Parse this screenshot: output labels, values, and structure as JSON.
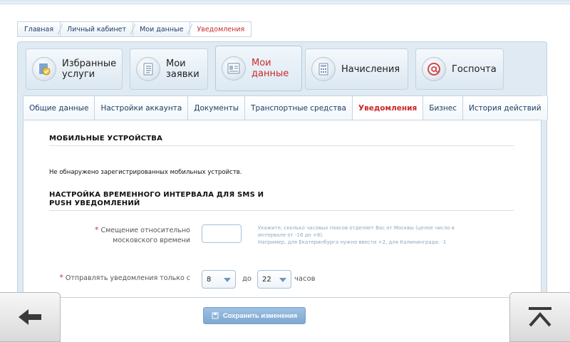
{
  "breadcrumb": [
    "Главная",
    "Личный кабинет",
    "Мои данные",
    "Уведомления"
  ],
  "big_tabs": [
    {
      "label": "Избранные\nуслуги",
      "icon": "favorite-services-icon",
      "active": false
    },
    {
      "label": "Мои\nзаявки",
      "icon": "applications-list-icon",
      "active": false
    },
    {
      "label": "Мои\nданные",
      "icon": "personal-data-icon",
      "active": true
    },
    {
      "label": "Начисления",
      "icon": "charges-calculator-icon",
      "active": false
    },
    {
      "label": "Госпочта",
      "icon": "gov-mail-at-icon",
      "active": false
    }
  ],
  "sub_tabs": [
    {
      "label": "Общие данные",
      "active": false
    },
    {
      "label": "Настройки аккаунта",
      "active": false
    },
    {
      "label": "Документы",
      "active": false
    },
    {
      "label": "Транспортные средства",
      "active": false
    },
    {
      "label": "Уведомления",
      "active": true
    },
    {
      "label": "Бизнес",
      "active": false
    },
    {
      "label": "История действий",
      "active": false
    }
  ],
  "content": {
    "mobile_title": "МОБИЛЬНЫЕ УСТРОЙСТВА",
    "no_devices_text": "Не обнаружено зарегистрированных мобильных устройств.",
    "interval_title_line1": "НАСТРОЙКА ВРЕМЕННОГО ИНТЕРВАЛА ДЛЯ SMS И",
    "interval_title_line2": "PUSH УВЕДОМЛЕНИЙ",
    "offset_label_line1": "Смещение относительно",
    "offset_label_line2": "московского времени",
    "offset_value": "",
    "hint_line1": "Укажите, сколько часовых поясов отделяет Вас от Москвы (целое число в",
    "hint_line2": "интервале от -16 до +8).",
    "hint_line3": "Например, для Екатеринбурга нужно ввести +2, для Калининграда: -1",
    "send_label": "Отправлять уведомления только с",
    "from_value": "8",
    "to_text": "до",
    "to_value": "22",
    "hours_text": "часов",
    "required_mark": "*",
    "save_label": "Сохранить изменения"
  },
  "colors": {
    "accent_red": "#cc2a2a",
    "link_blue": "#1d3f66",
    "panel_bg": "#dfeaf3",
    "button_blue": "#86aed6"
  }
}
